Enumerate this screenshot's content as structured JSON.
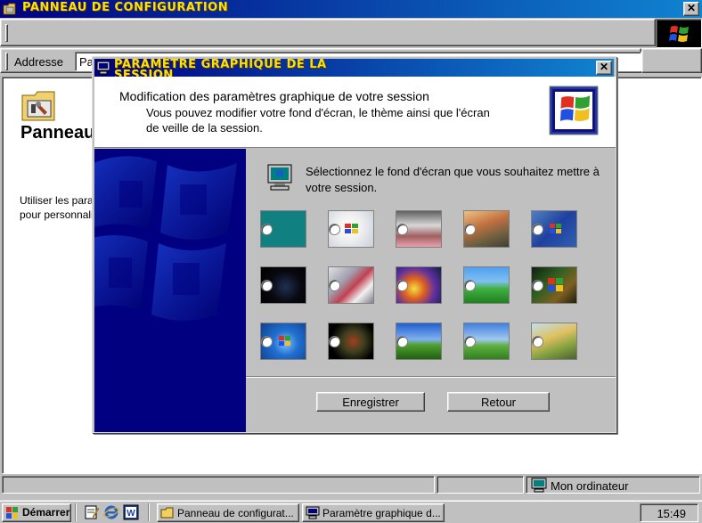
{
  "main_window": {
    "title": "PANNEAU DE CONFIGURATION",
    "close_glyph": "✕",
    "address_label": "Addresse",
    "address_value": "Panneau de configuration",
    "content_title": "Panneau de configuration",
    "content_desc": "Utiliser les paramètres du Panneau de configuration pour personnaliser l'ordinateur.",
    "status_computer": "Mon ordinateur"
  },
  "dialog": {
    "title": "PARAMÈTRE GRAPHIQUE DE LA SESSION",
    "close_glyph": "✕",
    "header_title": "Modification des paramètres graphique de votre session",
    "header_subtitle": "Vous pouvez modifier votre fond d'écran, le thème ainsi que l'écran de veille de la session.",
    "instruction": "Sélectionnez le fond d'écran que vous souhaitez mettre à votre session.",
    "wallpapers": [
      {
        "name": "teal",
        "selected": false
      },
      {
        "name": "windows-logo-white",
        "selected": false
      },
      {
        "name": "building",
        "selected": false
      },
      {
        "name": "autumn-valley",
        "selected": false
      },
      {
        "name": "windows-flag-blue",
        "selected": false
      },
      {
        "name": "windows-dark",
        "selected": false
      },
      {
        "name": "city-abstract",
        "selected": false
      },
      {
        "name": "colorful-abstract",
        "selected": false
      },
      {
        "name": "green-hills-tree",
        "selected": false
      },
      {
        "name": "windows-flag-dark",
        "selected": false
      },
      {
        "name": "windows7-blue",
        "selected": false
      },
      {
        "name": "dark-masks",
        "selected": false
      },
      {
        "name": "bliss-figure",
        "selected": false
      },
      {
        "name": "bliss-bird",
        "selected": false
      },
      {
        "name": "cartoon-characters",
        "selected": false
      }
    ],
    "save_button": "Enregistrer",
    "back_button": "Retour"
  },
  "taskbar": {
    "start_label": "Démarrer",
    "quick_launch": [
      "notepad-icon",
      "internet-explorer-icon",
      "word-icon"
    ],
    "tasks": [
      {
        "label": "Panneau de configurat...",
        "icon": "folder-icon"
      },
      {
        "label": "Paramètre graphique d...",
        "icon": "display-icon"
      }
    ],
    "clock": "15:49"
  },
  "colors": {
    "title_gradient_start": "#000080",
    "title_gradient_end": "#1084d0",
    "title_text": "#ffe000",
    "face": "#c0c0c0",
    "teal": "#008080"
  }
}
